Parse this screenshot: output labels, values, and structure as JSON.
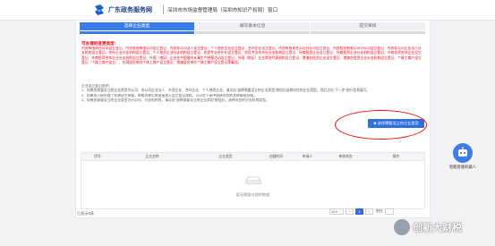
{
  "header": {
    "brand": "广东政务服务网",
    "subtitle": "深圳市市场监督管理局（深圳市知识产权局）窗口"
  },
  "steps": [
    "选择企业类型",
    "填写基本信息",
    "提交审核"
  ],
  "notice": {
    "title": "可办理的变更类型：",
    "body": "内资有限责任公司设立登记、内资股份有限公司设立登记、内资非公司法人设立登记、个人独资企业设立登记、合伙企业设立登记、内资有限责任公司分公司设立登记、内资股份有限公司分公司设立登记、内资非公司企业法人分支机构设立登记、合伙企业分支机构设立登记、个人独资企业分支机构设立登记、农民专业合作社设立登记、农民专业合作社分支机构设立登记、外商投资企业设立登记、外商投资企业分支机构设立登记、外商投资合伙企业设立登记、外商投资合伙企业分支机构设立登记、外国（地区）企业在中国境内从事生产经营活动设立登记、外国（地区）企业常驻代表机构设立登记、港澳台投资企业设立登记、港澳台投资企业分支机构设立登记、个体工商户设立登记（个体工商户设立）、台湾居民申办个体工商户设立登记、港澳居民申办个体工商户设立登记等事项。",
    "tips_heading": "企业设立登记说明：",
    "tips": [
      "1、如果您需要设立的企业类型为公司、非公司企业法人、外资企业、合伙企业、个人独资企业，请点击“选择需要设立的企业类型”按钮后选择对应的企业类型，然后点击“下一步”进行信息填写。",
      "2、如果您已经办理了名称自主申报，申报名称后将直接进入设立登记流程，可以在下表中选择对应的名称继续办理。",
      "3、如果您需要设立的企业类型为分公司、分支机构等，请点击“选择需要设立的企业类型”按钮后，选择对应的分支机构类型。"
    ]
  },
  "choose_button": "选择需要设立的企业类型",
  "table": {
    "columns": [
      "序号",
      "企业名称",
      "企业类型",
      "创建时间",
      "申请人",
      "审核状态",
      "操作"
    ],
    "empty_text": "暂无需要办理的数据"
  },
  "footer": {
    "total": "已显示0条",
    "page_size": "10",
    "current_page": "1",
    "goto_label": "前往"
  },
  "assistant": "智能客服机器人",
  "watermark": "创新大财税",
  "colors": {
    "primary": "#2f6fdc",
    "notice_red": "#e60012",
    "highlight_ellipse": "#e11111"
  }
}
